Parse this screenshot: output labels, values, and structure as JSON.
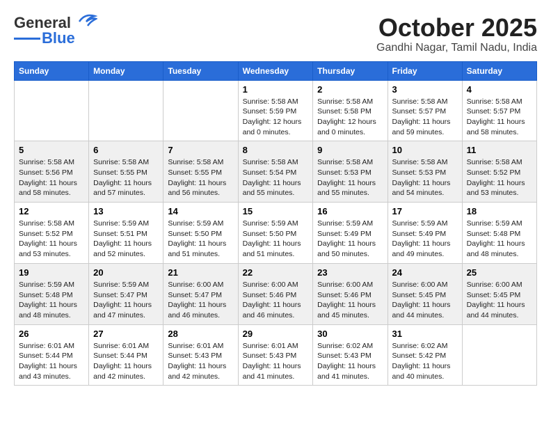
{
  "header": {
    "logo_general": "General",
    "logo_blue": "Blue",
    "month": "October 2025",
    "location": "Gandhi Nagar, Tamil Nadu, India"
  },
  "weekdays": [
    "Sunday",
    "Monday",
    "Tuesday",
    "Wednesday",
    "Thursday",
    "Friday",
    "Saturday"
  ],
  "weeks": [
    [
      {
        "day": "",
        "info": ""
      },
      {
        "day": "",
        "info": ""
      },
      {
        "day": "",
        "info": ""
      },
      {
        "day": "1",
        "info": "Sunrise: 5:58 AM\nSunset: 5:59 PM\nDaylight: 12 hours\nand 0 minutes."
      },
      {
        "day": "2",
        "info": "Sunrise: 5:58 AM\nSunset: 5:58 PM\nDaylight: 12 hours\nand 0 minutes."
      },
      {
        "day": "3",
        "info": "Sunrise: 5:58 AM\nSunset: 5:57 PM\nDaylight: 11 hours\nand 59 minutes."
      },
      {
        "day": "4",
        "info": "Sunrise: 5:58 AM\nSunset: 5:57 PM\nDaylight: 11 hours\nand 58 minutes."
      }
    ],
    [
      {
        "day": "5",
        "info": "Sunrise: 5:58 AM\nSunset: 5:56 PM\nDaylight: 11 hours\nand 58 minutes."
      },
      {
        "day": "6",
        "info": "Sunrise: 5:58 AM\nSunset: 5:55 PM\nDaylight: 11 hours\nand 57 minutes."
      },
      {
        "day": "7",
        "info": "Sunrise: 5:58 AM\nSunset: 5:55 PM\nDaylight: 11 hours\nand 56 minutes."
      },
      {
        "day": "8",
        "info": "Sunrise: 5:58 AM\nSunset: 5:54 PM\nDaylight: 11 hours\nand 55 minutes."
      },
      {
        "day": "9",
        "info": "Sunrise: 5:58 AM\nSunset: 5:53 PM\nDaylight: 11 hours\nand 55 minutes."
      },
      {
        "day": "10",
        "info": "Sunrise: 5:58 AM\nSunset: 5:53 PM\nDaylight: 11 hours\nand 54 minutes."
      },
      {
        "day": "11",
        "info": "Sunrise: 5:58 AM\nSunset: 5:52 PM\nDaylight: 11 hours\nand 53 minutes."
      }
    ],
    [
      {
        "day": "12",
        "info": "Sunrise: 5:58 AM\nSunset: 5:52 PM\nDaylight: 11 hours\nand 53 minutes."
      },
      {
        "day": "13",
        "info": "Sunrise: 5:59 AM\nSunset: 5:51 PM\nDaylight: 11 hours\nand 52 minutes."
      },
      {
        "day": "14",
        "info": "Sunrise: 5:59 AM\nSunset: 5:50 PM\nDaylight: 11 hours\nand 51 minutes."
      },
      {
        "day": "15",
        "info": "Sunrise: 5:59 AM\nSunset: 5:50 PM\nDaylight: 11 hours\nand 51 minutes."
      },
      {
        "day": "16",
        "info": "Sunrise: 5:59 AM\nSunset: 5:49 PM\nDaylight: 11 hours\nand 50 minutes."
      },
      {
        "day": "17",
        "info": "Sunrise: 5:59 AM\nSunset: 5:49 PM\nDaylight: 11 hours\nand 49 minutes."
      },
      {
        "day": "18",
        "info": "Sunrise: 5:59 AM\nSunset: 5:48 PM\nDaylight: 11 hours\nand 48 minutes."
      }
    ],
    [
      {
        "day": "19",
        "info": "Sunrise: 5:59 AM\nSunset: 5:48 PM\nDaylight: 11 hours\nand 48 minutes."
      },
      {
        "day": "20",
        "info": "Sunrise: 5:59 AM\nSunset: 5:47 PM\nDaylight: 11 hours\nand 47 minutes."
      },
      {
        "day": "21",
        "info": "Sunrise: 6:00 AM\nSunset: 5:47 PM\nDaylight: 11 hours\nand 46 minutes."
      },
      {
        "day": "22",
        "info": "Sunrise: 6:00 AM\nSunset: 5:46 PM\nDaylight: 11 hours\nand 46 minutes."
      },
      {
        "day": "23",
        "info": "Sunrise: 6:00 AM\nSunset: 5:46 PM\nDaylight: 11 hours\nand 45 minutes."
      },
      {
        "day": "24",
        "info": "Sunrise: 6:00 AM\nSunset: 5:45 PM\nDaylight: 11 hours\nand 44 minutes."
      },
      {
        "day": "25",
        "info": "Sunrise: 6:00 AM\nSunset: 5:45 PM\nDaylight: 11 hours\nand 44 minutes."
      }
    ],
    [
      {
        "day": "26",
        "info": "Sunrise: 6:01 AM\nSunset: 5:44 PM\nDaylight: 11 hours\nand 43 minutes."
      },
      {
        "day": "27",
        "info": "Sunrise: 6:01 AM\nSunset: 5:44 PM\nDaylight: 11 hours\nand 42 minutes."
      },
      {
        "day": "28",
        "info": "Sunrise: 6:01 AM\nSunset: 5:43 PM\nDaylight: 11 hours\nand 42 minutes."
      },
      {
        "day": "29",
        "info": "Sunrise: 6:01 AM\nSunset: 5:43 PM\nDaylight: 11 hours\nand 41 minutes."
      },
      {
        "day": "30",
        "info": "Sunrise: 6:02 AM\nSunset: 5:43 PM\nDaylight: 11 hours\nand 41 minutes."
      },
      {
        "day": "31",
        "info": "Sunrise: 6:02 AM\nSunset: 5:42 PM\nDaylight: 11 hours\nand 40 minutes."
      },
      {
        "day": "",
        "info": ""
      }
    ]
  ]
}
